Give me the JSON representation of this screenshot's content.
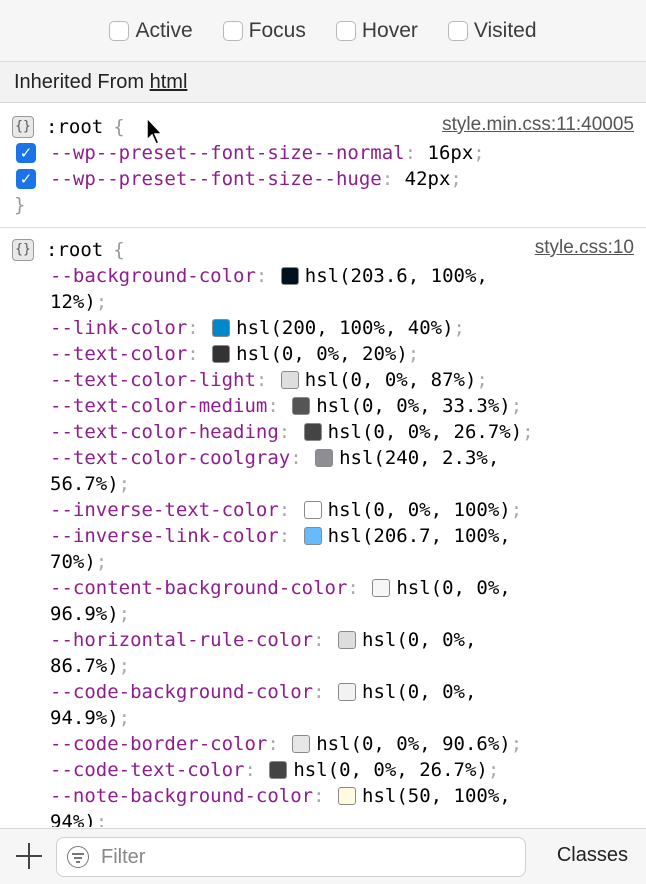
{
  "pseudo_classes": [
    "Active",
    "Focus",
    "Hover",
    "Visited"
  ],
  "inherited": {
    "prefix": "Inherited From ",
    "element": "html"
  },
  "rule1": {
    "icon": "rule-brace-icon",
    "selector": ":root",
    "open_brace": "{",
    "close_brace": "}",
    "source": "style.min.css:11:40005",
    "declarations": [
      {
        "prop": "--wp--preset--font-size--normal",
        "value": "16px",
        "enabled": true
      },
      {
        "prop": "--wp--preset--font-size--huge",
        "value": "42px",
        "enabled": true
      }
    ]
  },
  "rule2": {
    "icon": "rule-brace-icon",
    "selector": ":root",
    "open_brace": "{",
    "source": "style.css:10",
    "declarations": [
      {
        "prop": "--background-color",
        "swatch": "#00131f",
        "value": [
          "hsl(203.6, 100%,",
          "12%)"
        ]
      },
      {
        "prop": "--link-color",
        "swatch": "#0088cc",
        "value": [
          "hsl(200, 100%, 40%)"
        ]
      },
      {
        "prop": "--text-color",
        "swatch": "#333333",
        "value": [
          "hsl(0, 0%, 20%)"
        ]
      },
      {
        "prop": "--text-color-light",
        "swatch": "#dedede",
        "value": [
          "hsl(0, 0%, 87%)"
        ]
      },
      {
        "prop": "--text-color-medium",
        "swatch": "#555555",
        "value": [
          "hsl(0, 0%, 33.3%)"
        ]
      },
      {
        "prop": "--text-color-heading",
        "swatch": "#444444",
        "value": [
          "hsl(0, 0%, 26.7%)"
        ]
      },
      {
        "prop": "--text-color-coolgray",
        "swatch": "#8d8d93",
        "value": [
          "hsl(240, 2.3%,",
          "56.7%)"
        ]
      },
      {
        "prop": "--inverse-text-color",
        "swatch": "#ffffff",
        "value": [
          "hsl(0, 0%, 100%)"
        ]
      },
      {
        "prop": "--inverse-link-color",
        "swatch": "#66bbff",
        "value": [
          "hsl(206.7, 100%,",
          "70%)"
        ]
      },
      {
        "prop": "--content-background-color",
        "swatch": "#f7f7f7",
        "value": [
          "hsl(0, 0%,",
          "96.9%)"
        ]
      },
      {
        "prop": "--horizontal-rule-color",
        "swatch": "#dddddd",
        "value": [
          "hsl(0, 0%,",
          "86.7%)"
        ]
      },
      {
        "prop": "--code-background-color",
        "swatch": "#f2f2f2",
        "value": [
          "hsl(0, 0%,",
          "94.9%)"
        ]
      },
      {
        "prop": "--code-border-color",
        "swatch": "#e7e7e7",
        "value": [
          "hsl(0, 0%, 90.6%)"
        ]
      },
      {
        "prop": "--code-text-color",
        "swatch": "#444444",
        "value": [
          "hsl(0, 0%, 26.7%)"
        ]
      },
      {
        "prop": "--note-background-color",
        "swatch": "#fffae0",
        "value": [
          "hsl(50, 100%,",
          "94%)"
        ]
      }
    ]
  },
  "bottom": {
    "filter_placeholder": "Filter",
    "classes_label": "Classes"
  }
}
